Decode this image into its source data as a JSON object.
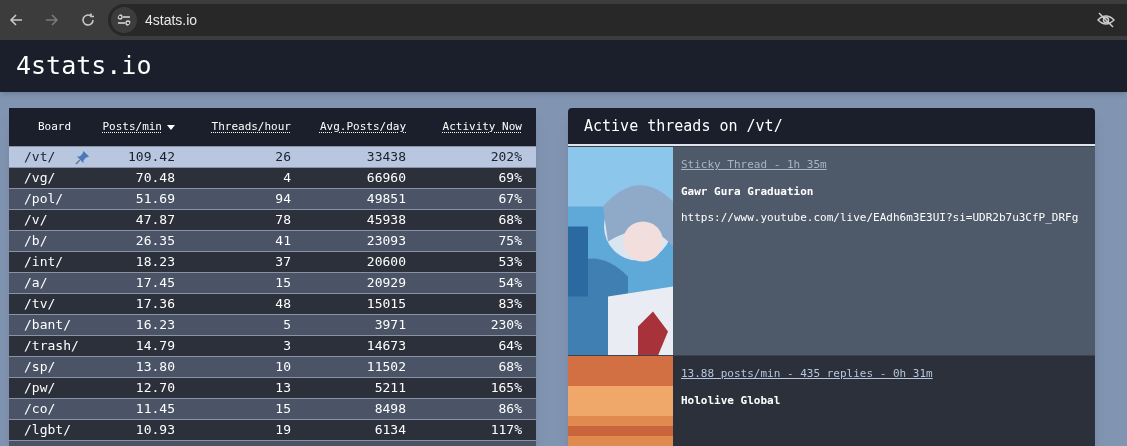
{
  "browser": {
    "url": "4stats.io"
  },
  "site": {
    "title": "4stats.io"
  },
  "table": {
    "columns": [
      {
        "label": "Board",
        "sortable": false,
        "sorted": false
      },
      {
        "label": "Posts/min",
        "sortable": true,
        "sorted": true
      },
      {
        "label": "Threads/hour",
        "sortable": true,
        "sorted": false
      },
      {
        "label": "Avg.Posts/day",
        "sortable": true,
        "sorted": false
      },
      {
        "label": "Activity Now",
        "sortable": true,
        "sorted": false
      }
    ],
    "rows": [
      {
        "board": "/vt/",
        "pinned": true,
        "selected": true,
        "posts_min": "109.42",
        "threads_hour": "26",
        "avg_posts_day": "33438",
        "activity": "202%"
      },
      {
        "board": "/vg/",
        "pinned": false,
        "selected": false,
        "posts_min": "70.48",
        "threads_hour": "4",
        "avg_posts_day": "66960",
        "activity": "69%"
      },
      {
        "board": "/pol/",
        "pinned": false,
        "selected": false,
        "posts_min": "51.69",
        "threads_hour": "94",
        "avg_posts_day": "49851",
        "activity": "67%"
      },
      {
        "board": "/v/",
        "pinned": false,
        "selected": false,
        "posts_min": "47.87",
        "threads_hour": "78",
        "avg_posts_day": "45938",
        "activity": "68%"
      },
      {
        "board": "/b/",
        "pinned": false,
        "selected": false,
        "posts_min": "26.35",
        "threads_hour": "41",
        "avg_posts_day": "23093",
        "activity": "75%"
      },
      {
        "board": "/int/",
        "pinned": false,
        "selected": false,
        "posts_min": "18.23",
        "threads_hour": "37",
        "avg_posts_day": "20600",
        "activity": "53%"
      },
      {
        "board": "/a/",
        "pinned": false,
        "selected": false,
        "posts_min": "17.45",
        "threads_hour": "15",
        "avg_posts_day": "20929",
        "activity": "54%"
      },
      {
        "board": "/tv/",
        "pinned": false,
        "selected": false,
        "posts_min": "17.36",
        "threads_hour": "48",
        "avg_posts_day": "15015",
        "activity": "83%"
      },
      {
        "board": "/bant/",
        "pinned": false,
        "selected": false,
        "posts_min": "16.23",
        "threads_hour": "5",
        "avg_posts_day": "3971",
        "activity": "230%"
      },
      {
        "board": "/trash/",
        "pinned": false,
        "selected": false,
        "posts_min": "14.79",
        "threads_hour": "3",
        "avg_posts_day": "14673",
        "activity": "64%"
      },
      {
        "board": "/sp/",
        "pinned": false,
        "selected": false,
        "posts_min": "13.80",
        "threads_hour": "10",
        "avg_posts_day": "11502",
        "activity": "68%"
      },
      {
        "board": "/pw/",
        "pinned": false,
        "selected": false,
        "posts_min": "12.70",
        "threads_hour": "13",
        "avg_posts_day": "5211",
        "activity": "165%"
      },
      {
        "board": "/co/",
        "pinned": false,
        "selected": false,
        "posts_min": "11.45",
        "threads_hour": "15",
        "avg_posts_day": "8498",
        "activity": "86%"
      },
      {
        "board": "/lgbt/",
        "pinned": false,
        "selected": false,
        "posts_min": "10.93",
        "threads_hour": "19",
        "avg_posts_day": "6134",
        "activity": "117%"
      }
    ]
  },
  "threads_panel": {
    "title": "Active threads on /vt/",
    "threads": [
      {
        "kind": "sticky",
        "meta": "Sticky Thread - 1h 35m",
        "subject": "Gawr Gura Graduation",
        "body": "https://www.youtube.com/live/EAdh6m3E3UI?si=UDR2b7u3CfP_DRFg"
      },
      {
        "kind": "normal",
        "meta": "13.88 posts/min - 435 replies - 0h 31m",
        "subject": "Hololive Global"
      }
    ]
  }
}
